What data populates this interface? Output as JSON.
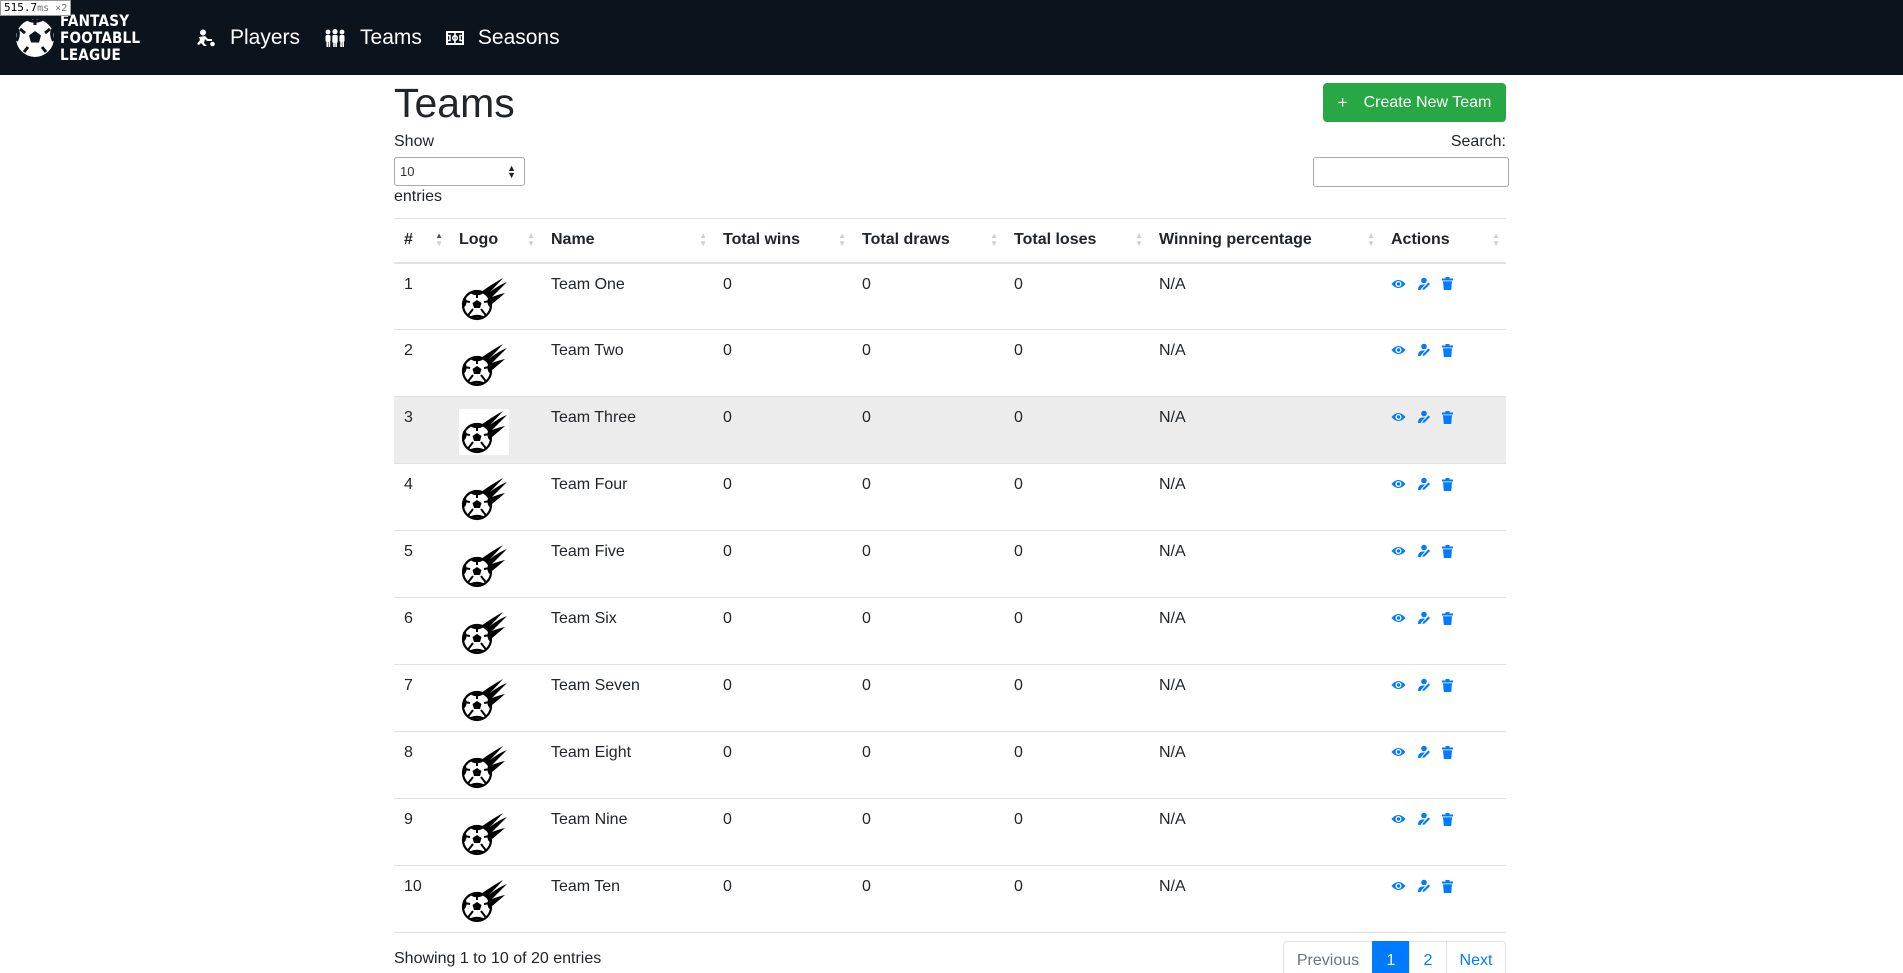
{
  "perf_badge": {
    "value": "515.7",
    "unit": "ms ×2"
  },
  "navbar": {
    "brand_lines": [
      "FANTASY",
      "FOOTABLL",
      "LEAGUE"
    ],
    "links": [
      {
        "label": "Players",
        "icon": "player-icon"
      },
      {
        "label": "Teams",
        "icon": "team-icon"
      },
      {
        "label": "Seasons",
        "icon": "field-icon"
      }
    ]
  },
  "page": {
    "title": "Teams",
    "create_button": {
      "icon": "+",
      "label": "Create New Team"
    }
  },
  "length_menu": {
    "show_label": "Show",
    "value": "10",
    "entries_label": "entries"
  },
  "search": {
    "label": "Search:",
    "value": ""
  },
  "table": {
    "headers": [
      "#",
      "Logo",
      "Name",
      "Total wins",
      "Total draws",
      "Total loses",
      "Winning percentage",
      "Actions"
    ],
    "rows": [
      {
        "id": "1",
        "name": "Team One",
        "wins": "0",
        "draws": "0",
        "loses": "0",
        "pct": "N/A"
      },
      {
        "id": "2",
        "name": "Team Two",
        "wins": "0",
        "draws": "0",
        "loses": "0",
        "pct": "N/A"
      },
      {
        "id": "3",
        "name": "Team Three",
        "wins": "0",
        "draws": "0",
        "loses": "0",
        "pct": "N/A"
      },
      {
        "id": "4",
        "name": "Team Four",
        "wins": "0",
        "draws": "0",
        "loses": "0",
        "pct": "N/A"
      },
      {
        "id": "5",
        "name": "Team Five",
        "wins": "0",
        "draws": "0",
        "loses": "0",
        "pct": "N/A"
      },
      {
        "id": "6",
        "name": "Team Six",
        "wins": "0",
        "draws": "0",
        "loses": "0",
        "pct": "N/A"
      },
      {
        "id": "7",
        "name": "Team Seven",
        "wins": "0",
        "draws": "0",
        "loses": "0",
        "pct": "N/A"
      },
      {
        "id": "8",
        "name": "Team Eight",
        "wins": "0",
        "draws": "0",
        "loses": "0",
        "pct": "N/A"
      },
      {
        "id": "9",
        "name": "Team Nine",
        "wins": "0",
        "draws": "0",
        "loses": "0",
        "pct": "N/A"
      },
      {
        "id": "10",
        "name": "Team Ten",
        "wins": "0",
        "draws": "0",
        "loses": "0",
        "pct": "N/A"
      }
    ],
    "highlighted_row": 3,
    "row_actions": [
      "view-icon",
      "edit-icon",
      "delete-icon"
    ]
  },
  "footer": {
    "info": "Showing 1 to 10 of 20 entries",
    "pagination": {
      "previous": "Previous",
      "pages": [
        "1",
        "2"
      ],
      "active_page": "1",
      "next": "Next"
    }
  },
  "colors": {
    "navbar_bg": "#0b131d",
    "primary": "#007bff",
    "success": "#28a745",
    "row_highlight": "#ececec"
  }
}
